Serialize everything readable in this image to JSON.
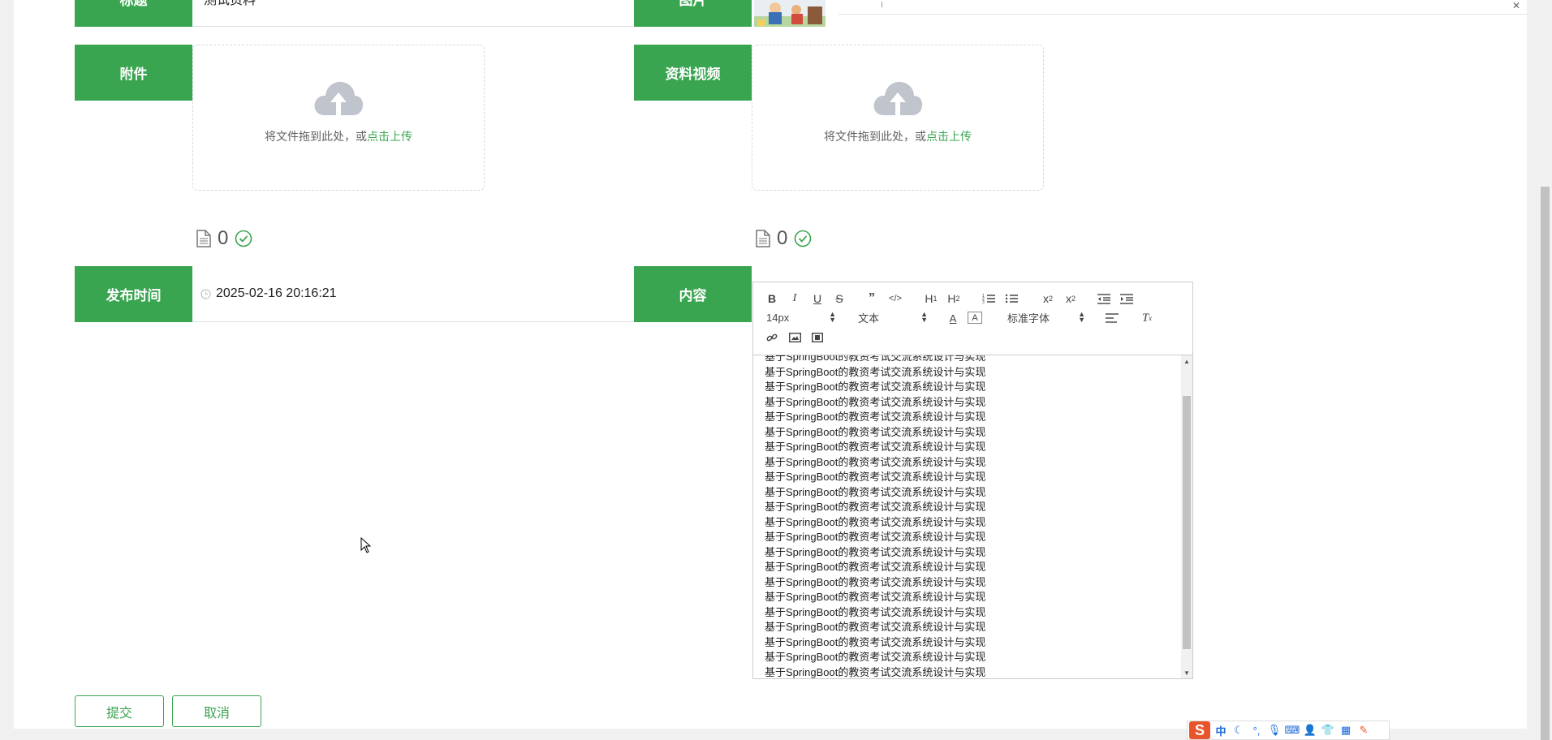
{
  "form": {
    "title_label": "标题",
    "title_value": "测试资料",
    "image_label": "图片",
    "attachment_label": "附件",
    "video_label": "资料视频",
    "upload_text": "将文件拖到此处，或",
    "upload_link": "点击上传",
    "attachment_count": "0",
    "video_count": "0",
    "publish_label": "发布时间",
    "publish_value": "2025-02-16 20:16:21",
    "content_label": "内容"
  },
  "editor": {
    "font_size": "14px",
    "paragraph": "文本",
    "font_family": "标准字体",
    "content_line": "基于SpringBoot的教资考试交流系统设计与实现",
    "line_count": 22
  },
  "actions": {
    "submit": "提交",
    "cancel": "取消"
  },
  "ime": {
    "logo": "S",
    "mode": "中"
  },
  "colors": {
    "accent": "#3aa550"
  }
}
